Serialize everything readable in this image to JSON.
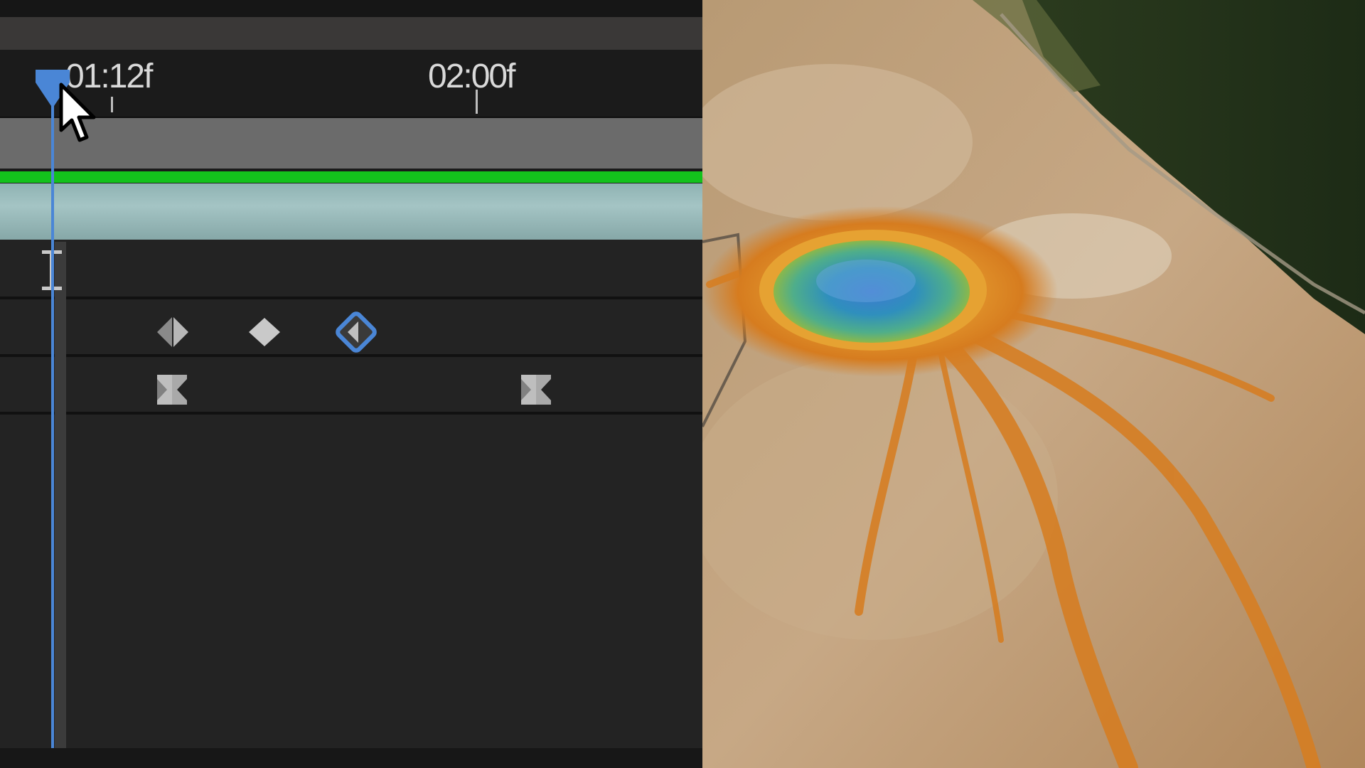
{
  "timeline": {
    "ruler": {
      "marks": [
        {
          "label": "01:12f"
        },
        {
          "label": "02:00f"
        }
      ]
    },
    "colors": {
      "playhead": "#4a86d6",
      "work_area_bar": "#13c21c",
      "layer_bar": "#9dbdbd",
      "selected_keyframe": "#4a86d6"
    },
    "icons": {
      "playhead": "playhead-marker-icon",
      "cursor": "mouse-pointer-icon",
      "keyframe": "keyframe-diamond-icon",
      "hold_keyframe": "hold-keyframe-icon",
      "ibeam": "text-cursor-icon"
    },
    "property_rows": [
      {
        "keyframes": [
          "half-diamond",
          "diamond",
          "selected-half-diamond"
        ]
      },
      {
        "keyframes": [
          "hold",
          "hold"
        ]
      }
    ]
  },
  "preview": {
    "content": "aerial-hot-spring-image"
  }
}
